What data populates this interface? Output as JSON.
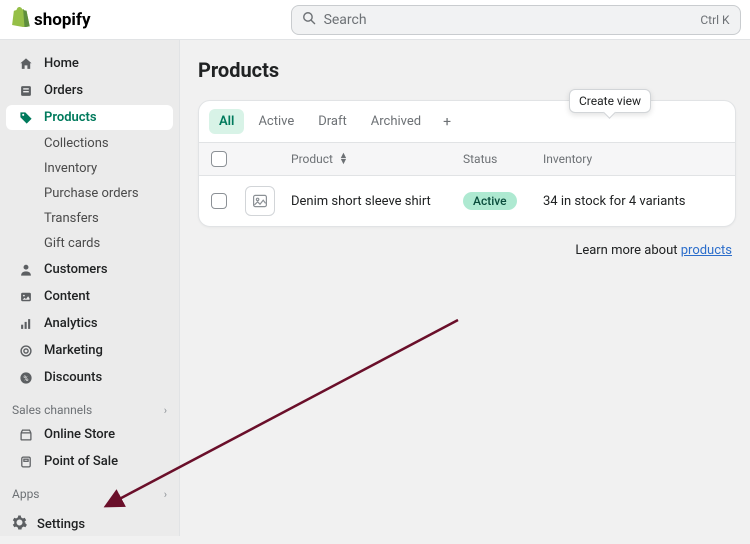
{
  "brand": "shopify",
  "search": {
    "placeholder": "Search",
    "shortcut": "Ctrl K"
  },
  "nav": {
    "home": "Home",
    "orders": "Orders",
    "products": "Products",
    "collections": "Collections",
    "inventory": "Inventory",
    "purchase_orders": "Purchase orders",
    "transfers": "Transfers",
    "gift_cards": "Gift cards",
    "customers": "Customers",
    "content": "Content",
    "analytics": "Analytics",
    "marketing": "Marketing",
    "discounts": "Discounts"
  },
  "sections": {
    "sales_channels": "Sales channels",
    "online_store": "Online Store",
    "point_of_sale": "Point of Sale",
    "apps": "Apps"
  },
  "settings_label": "Settings",
  "page": {
    "title": "Products",
    "tooltip": "Create view",
    "tabs": {
      "all": "All",
      "active": "Active",
      "draft": "Draft",
      "archived": "Archived"
    },
    "columns": {
      "product": "Product",
      "status": "Status",
      "inventory": "Inventory"
    },
    "row": {
      "name": "Denim short sleeve shirt",
      "status": "Active",
      "inventory": "34 in stock for 4 variants"
    },
    "learn_prefix": "Learn more about ",
    "learn_link": "products"
  }
}
